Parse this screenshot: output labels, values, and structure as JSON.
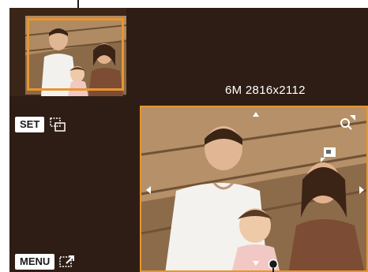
{
  "resolution": {
    "size_code": "6M",
    "dimensions": "2816x2112"
  },
  "controls": {
    "set_key": "SET",
    "set_icon": "crop-frame-icon",
    "menu_key": "MENU",
    "menu_icon": "return-icon"
  },
  "thumbnail": {
    "icon": "full-image-preview"
  },
  "zoom_view": {
    "zoom_icon": "magnify-zoom-icon",
    "nav_icon": "position-navigator-icon",
    "arrows": [
      "up-arrow-icon",
      "down-arrow-icon",
      "left-arrow-icon",
      "right-arrow-icon"
    ]
  },
  "colors": {
    "accent": "#e8952f",
    "background": "#2e1d14",
    "text": "#ffffff"
  }
}
